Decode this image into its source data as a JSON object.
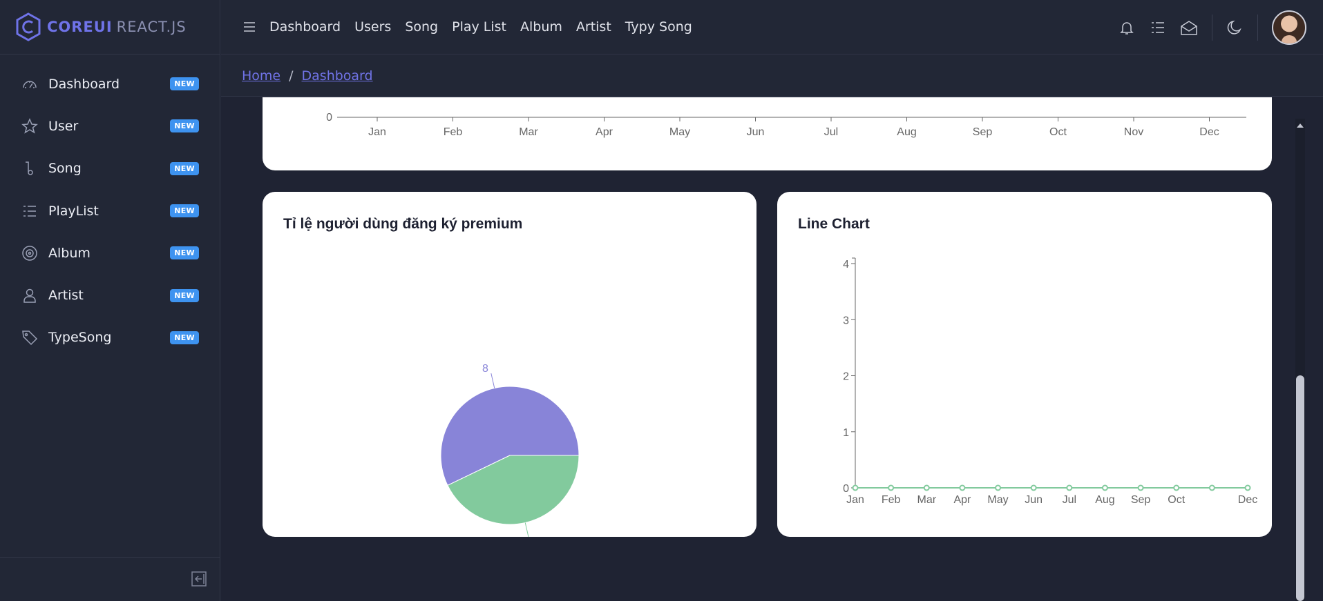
{
  "brand": {
    "core": "COREUI",
    "react": "REACT.JS"
  },
  "sidebar": {
    "items": [
      {
        "label": "Dashboard",
        "icon": "speedometer-icon",
        "badge": "NEW"
      },
      {
        "label": "User",
        "icon": "star-icon",
        "badge": "NEW"
      },
      {
        "label": "Song",
        "icon": "music-note-icon",
        "badge": "NEW"
      },
      {
        "label": "PlayList",
        "icon": "list-icon",
        "badge": "NEW"
      },
      {
        "label": "Album",
        "icon": "disc-icon",
        "badge": "NEW"
      },
      {
        "label": "Artist",
        "icon": "user-icon",
        "badge": "NEW"
      },
      {
        "label": "TypeSong",
        "icon": "tag-icon",
        "badge": "NEW"
      }
    ]
  },
  "header": {
    "nav": [
      "Dashboard",
      "Users",
      "Song",
      "Play List",
      "Album",
      "Artist",
      "Typy Song"
    ]
  },
  "breadcrumb": {
    "home": "Home",
    "separator": "/",
    "current": "Dashboard"
  },
  "colors": {
    "accent": "#7073e6",
    "badge": "#3e93f0",
    "pie_purple": "#8884d8",
    "pie_green": "#82ca9d",
    "line_green": "#82ca9d"
  },
  "top_chart": {
    "partial_y_label": "0",
    "categories": [
      "Jan",
      "Feb",
      "Mar",
      "Apr",
      "May",
      "Jun",
      "Jul",
      "Aug",
      "Sep",
      "Oct",
      "Nov",
      "Dec"
    ]
  },
  "pie_card": {
    "title": "Tỉ lệ người dùng đăng ký premium"
  },
  "line_card": {
    "title": "Line Chart"
  },
  "chart_data": [
    {
      "type": "pie",
      "title": "Tỉ lệ người dùng đăng ký premium",
      "slices": [
        {
          "value": 8,
          "color": "#8884d8"
        },
        {
          "value": 6,
          "color": "#82ca9d"
        }
      ]
    },
    {
      "type": "line",
      "title": "Line Chart",
      "categories": [
        "Jan",
        "Feb",
        "Mar",
        "Apr",
        "May",
        "Jun",
        "Jul",
        "Aug",
        "Sep",
        "Oct",
        "",
        "Dec"
      ],
      "series": [
        {
          "values": [
            0,
            0,
            0,
            0,
            0,
            0,
            0,
            0,
            0,
            0,
            0,
            0
          ],
          "color": "#82ca9d"
        }
      ],
      "yticks": [
        0,
        1,
        2,
        3,
        4
      ],
      "ylim": [
        0,
        4
      ]
    }
  ]
}
